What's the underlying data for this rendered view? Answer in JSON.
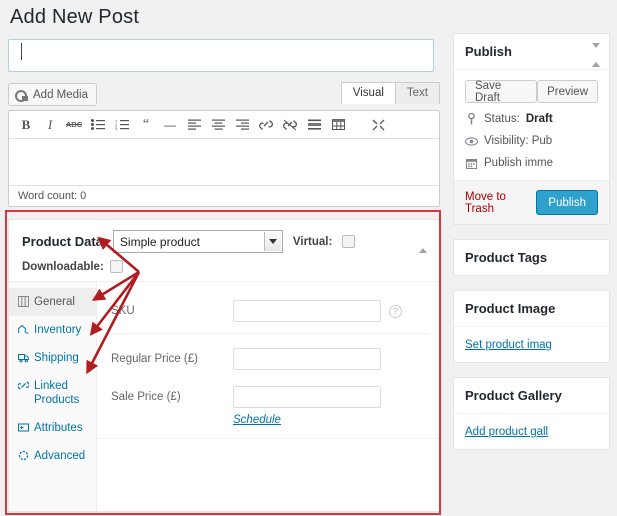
{
  "page": {
    "title": "Add New Post"
  },
  "title_field": {
    "value": "",
    "placeholder": ""
  },
  "editor": {
    "add_media_label": "Add Media",
    "tabs": [
      {
        "label": "Visual",
        "active": true
      },
      {
        "label": "Text",
        "active": false
      }
    ],
    "toolbar_icons": [
      "bold-icon",
      "italic-icon",
      "strikethrough-icon",
      "bulleted-list-icon",
      "numbered-list-icon",
      "blockquote-icon",
      "horizontal-rule-icon",
      "align-left-icon",
      "align-center-icon",
      "align-right-icon",
      "link-icon",
      "unlink-icon",
      "insert-more-icon",
      "kitchen-sink-icon",
      "fullscreen-icon"
    ],
    "toolbar_labels": {
      "bold": "B",
      "italic": "I",
      "strike": "ABC",
      "quote": "“",
      "rule": "—"
    },
    "content": "",
    "word_count": "Word count: 0"
  },
  "product_data": {
    "title": "Product Data",
    "product_type": "Simple product",
    "product_type_options": [
      "Simple product"
    ],
    "virtual_label": "Virtual:",
    "virtual_checked": false,
    "downloadable_label": "Downloadable:",
    "downloadable_checked": false,
    "tabs": [
      {
        "label": "General",
        "icon": "general-icon",
        "active": true
      },
      {
        "label": "Inventory",
        "icon": "inventory-icon",
        "active": false
      },
      {
        "label": "Shipping",
        "icon": "shipping-icon",
        "active": false
      },
      {
        "label": "Linked Products",
        "icon": "linked-products-icon",
        "active": false
      },
      {
        "label": "Attributes",
        "icon": "attributes-icon",
        "active": false
      },
      {
        "label": "Advanced",
        "icon": "advanced-icon",
        "active": false
      }
    ],
    "fields": [
      {
        "label": "SKU",
        "value": "",
        "help": "?"
      },
      {
        "label": "Regular Price (£)",
        "value": ""
      },
      {
        "label": "Sale Price (£)",
        "value": ""
      }
    ],
    "schedule_link": "Schedule"
  },
  "annotation": {
    "color": "#d9363e",
    "arrow_targets": [
      "Product Data",
      "General",
      "Inventory",
      "Shipping"
    ]
  },
  "sidebar": {
    "publish": {
      "title": "Publish",
      "save_draft": "Save Draft",
      "preview": "Preview",
      "status_prefix": "Status:",
      "status_value": "Draft",
      "visibility_text": "Visibility: Pub",
      "schedule_text": "Publish imme",
      "move_to_trash": "Move to Trash",
      "publish_button": "Publish"
    },
    "product_tags": {
      "title": "Product Tags"
    },
    "product_image": {
      "title": "Product Image",
      "link": "Set product imag"
    },
    "product_gallery": {
      "title": "Product Gallery",
      "link": "Add product gall"
    }
  }
}
